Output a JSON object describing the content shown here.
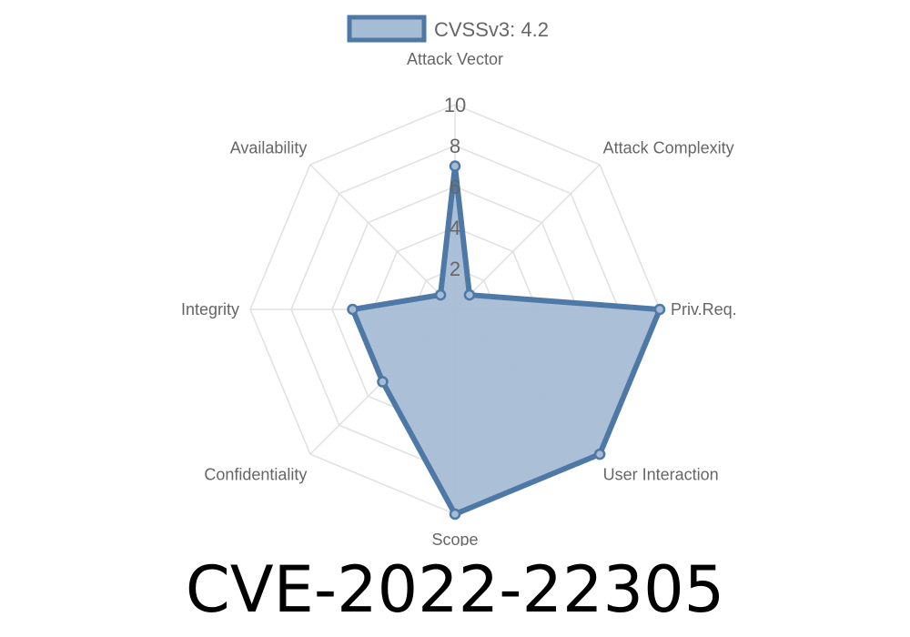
{
  "chart_data": {
    "type": "radar",
    "legend": {
      "label": "CVSSv3: 4.2",
      "position": "top"
    },
    "axes": [
      "Attack Vector",
      "Attack Complexity",
      "Priv.Req.",
      "User Interaction",
      "Scope",
      "Confidentiality",
      "Integrity",
      "Availability"
    ],
    "series": [
      {
        "name": "CVSSv3: 4.2",
        "values": [
          7,
          1,
          10,
          10,
          10,
          5,
          5,
          1
        ]
      }
    ],
    "r_range": [
      0,
      10
    ],
    "r_ticks": [
      "2",
      "4",
      "6",
      "8",
      "10"
    ],
    "r_tick_values": [
      2,
      4,
      6,
      8,
      10
    ],
    "grid": true,
    "colors": {
      "line": "#4e79a7",
      "fill": "#a6bcd5",
      "grid": "#e0e0e0",
      "text": "#666666"
    }
  },
  "title": "CVE-2022-22305"
}
